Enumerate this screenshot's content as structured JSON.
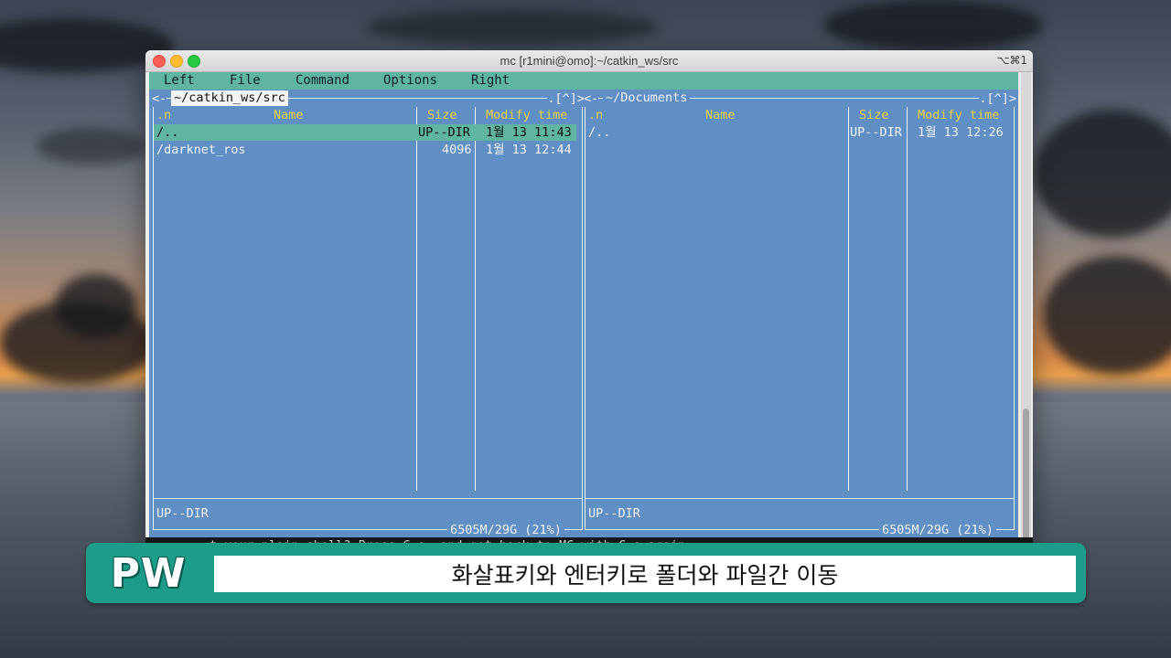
{
  "window": {
    "title": "mc [r1mini@omo]:~/catkin_ws/src",
    "shortcut": "⌥⌘1"
  },
  "menu": {
    "items": [
      "Left",
      "File",
      "Command",
      "Options",
      "Right"
    ]
  },
  "left_panel": {
    "path": "~/catkin_ws/src",
    "corner_left": "<-",
    "corner_right": ".[^]>",
    "headers": {
      "sort": ".n",
      "name": "Name",
      "size": "Size",
      "mtime": "Modify time"
    },
    "rows": [
      {
        "name": "/..",
        "size": "UP--DIR",
        "mtime": "1월 13 11:43",
        "selected": true
      },
      {
        "name": "/darknet_ros",
        "size": "4096",
        "mtime": "1월 13 12:44",
        "selected": false
      }
    ],
    "status": "UP--DIR",
    "disk": "6505M/29G (21%)"
  },
  "right_panel": {
    "path": "~/Documents",
    "corner_left": "<-",
    "corner_right": ".[^]>",
    "headers": {
      "sort": ".n",
      "name": "Name",
      "size": "Size",
      "mtime": "Modify time"
    },
    "rows": [
      {
        "name": "/..",
        "size": "UP--DIR",
        "mtime": "1월 13 12:26",
        "selected": false
      }
    ],
    "status": "UP--DIR",
    "disk": "6505M/29G (21%)"
  },
  "hint": "t your plain shell? Press C-o, and get back to MC with C-o again.",
  "caption": {
    "badge": "PW",
    "text": "화살표키와 엔터키로 폴더와 파일간 이동"
  }
}
